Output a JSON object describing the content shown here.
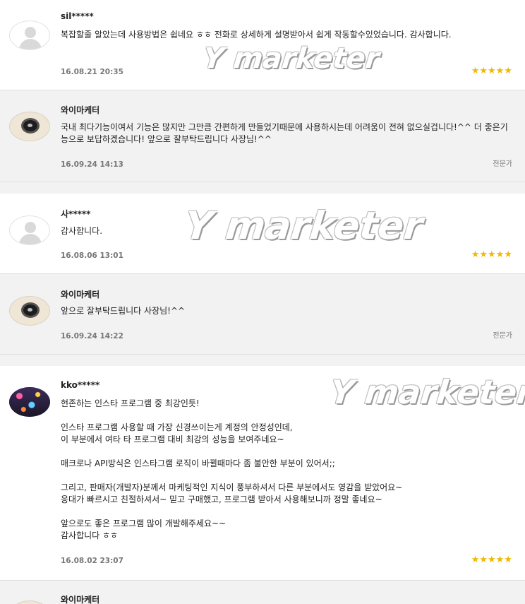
{
  "reviews": [
    {
      "author": "sil*****",
      "text": [
        "복잡할줄 알았는데 사용방법은 쉽네요 ㅎㅎ 전화로 상세하게 설명받아서 쉽게 작동할수있었습니다. 감사합니다."
      ],
      "date": "16.08.21 20:35",
      "stars": "★★★★★",
      "rating": 5,
      "avatar": "default-avatar-icon",
      "reply": {
        "author": "와이마케터",
        "text": [
          "국내 최다기능이여서 기능은 많지만 그만큼 간편하게 만들었기때문에 사용하시는데 어려움이 전혀 없으실겁니다!^^ 더 좋은기능으로 보답하겠습니다! 앞으로 잘부탁드립니다 사장님!^^"
        ],
        "date": "16.09.24 14:13",
        "badge": "전문가",
        "avatar": "camera-avatar-icon"
      }
    },
    {
      "author": "사*****",
      "text": [
        "감사합니다."
      ],
      "date": "16.08.06 13:01",
      "stars": "★★★★★",
      "rating": 5,
      "avatar": "default-avatar-icon",
      "reply": {
        "author": "와이마케터",
        "text": [
          "앞으로 잘부탁드립니다 사장님!^^"
        ],
        "date": "16.09.24 14:22",
        "badge": "전문가",
        "avatar": "camera-avatar-icon"
      }
    },
    {
      "author": "kko*****",
      "text": [
        "현존하는 인스타 프로그램 중 최강인듯!",
        "",
        "인스타 프로그램 사용할 때 가장 신경쓰이는게 계정의 안정성인데,",
        "이 부분에서 여타 타 프로그램 대비 최강의 성능을 보여주네요~",
        "",
        "매크로나 API방식은 인스타그램 로직이 바뀔때마다 좀 불안한 부분이 있어서;;",
        "",
        "그리고, 판매자(개발자)분께서 마케팅적인 지식이 풍부하셔서 다른 부분에서도 영감을 받았어요~",
        "응대가 빠르시고 친절하셔서~ 믿고 구매했고, 프로그램 받아서 사용해보니까 정말 좋네요~",
        "",
        "앞으로도 좋은 프로그램 많이 개발해주세요~~",
        "감사합니다 ㅎㅎ"
      ],
      "date": "16.08.02 23:07",
      "stars": "★★★★★",
      "rating": 5,
      "avatar": "night-city-photo-avatar",
      "reply": {
        "author": "와이마케터",
        "avatar": "camera-avatar-icon"
      }
    }
  ],
  "watermarks": [
    "Y marketer",
    "Y marketer",
    "Y marketer"
  ]
}
